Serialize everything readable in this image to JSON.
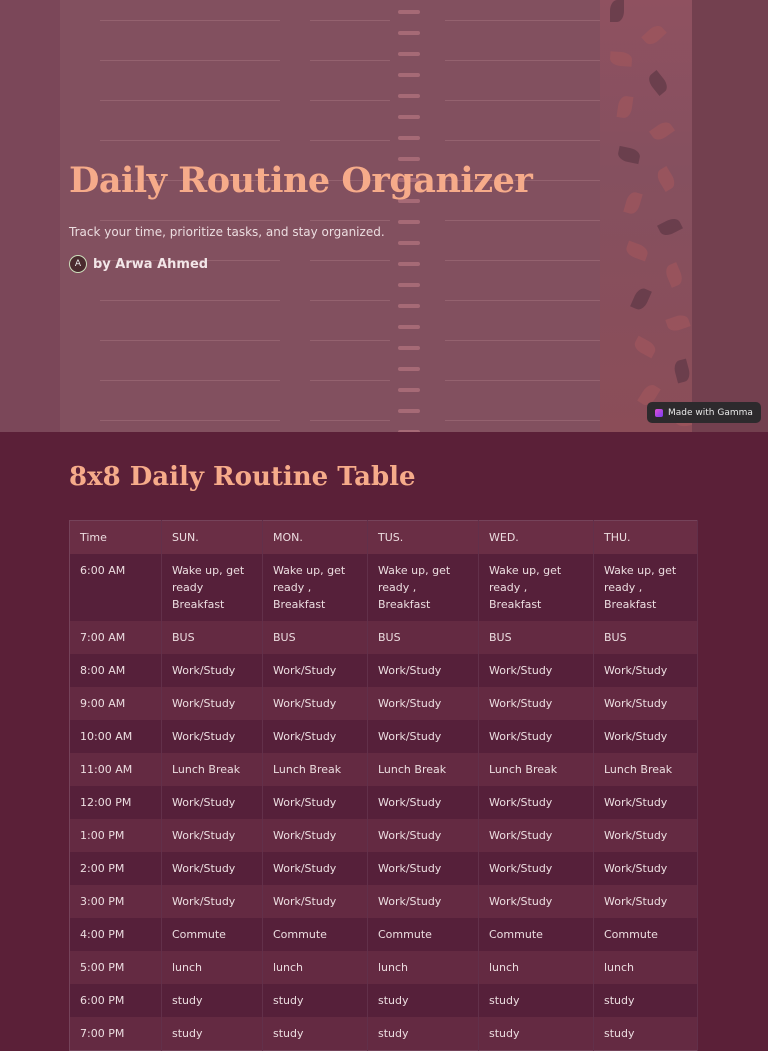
{
  "hero": {
    "title": "Daily Routine Organizer",
    "subtitle": "Track your time, prioritize tasks, and stay organized.",
    "author_initial": "A",
    "author": "by Arwa Ahmed",
    "badge": "Made with Gamma"
  },
  "table_section": {
    "title": "8x8 Daily Routine Table",
    "headers": [
      "Time",
      "SUN.",
      "MON.",
      "TUS.",
      "WED.",
      "THU."
    ],
    "rows": [
      [
        "6:00 AM",
        "Wake up, get ready\nBreakfast",
        "Wake up, get ready , Breakfast",
        "Wake up, get ready , Breakfast",
        "Wake up, get ready , Breakfast",
        "Wake up, get ready , Breakfast"
      ],
      [
        "7:00 AM",
        "BUS",
        "BUS",
        "BUS",
        "BUS",
        "BUS"
      ],
      [
        "8:00 AM",
        "Work/Study",
        "Work/Study",
        "Work/Study",
        "Work/Study",
        "Work/Study"
      ],
      [
        "9:00 AM",
        "Work/Study",
        "Work/Study",
        "Work/Study",
        "Work/Study",
        "Work/Study"
      ],
      [
        "10:00 AM",
        "Work/Study",
        "Work/Study",
        "Work/Study",
        "Work/Study",
        "Work/Study"
      ],
      [
        "11:00 AM",
        "Lunch Break",
        "Lunch Break",
        "Lunch Break",
        "Lunch Break",
        "Lunch Break"
      ],
      [
        "12:00 PM",
        "Work/Study",
        "Work/Study",
        "Work/Study",
        "Work/Study",
        "Work/Study"
      ],
      [
        "1:00 PM",
        "Work/Study",
        "Work/Study",
        "Work/Study",
        "Work/Study",
        "Work/Study"
      ],
      [
        "2:00 PM",
        "Work/Study",
        "Work/Study",
        "Work/Study",
        "Work/Study",
        "Work/Study"
      ],
      [
        "3:00 PM",
        "Work/Study",
        "Work/Study",
        "Work/Study",
        "Work/Study",
        "Work/Study"
      ],
      [
        "4:00 PM",
        "Commute",
        "Commute",
        "Commute",
        "Commute",
        "Commute"
      ],
      [
        "5:00 PM",
        "lunch",
        "lunch",
        "lunch",
        "lunch",
        "lunch"
      ],
      [
        "6:00 PM",
        "study",
        "study",
        "study",
        "study",
        "study"
      ],
      [
        "7:00 PM",
        "study",
        "study",
        "study",
        "study",
        "study"
      ]
    ]
  }
}
